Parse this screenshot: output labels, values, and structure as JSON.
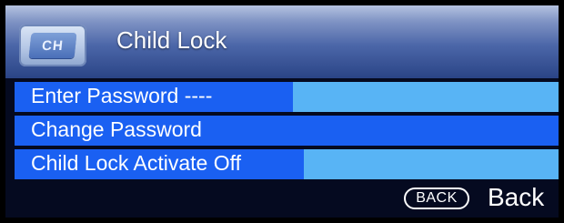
{
  "menu": {
    "logo_text": "CH",
    "title": "Child Lock",
    "items": [
      {
        "label": "Enter Password ----"
      },
      {
        "label": "Change Password"
      },
      {
        "label": "Child Lock Activate Off"
      }
    ]
  },
  "footer": {
    "back_key": "BACK",
    "back_label": "Back"
  },
  "colors": {
    "row_blue": "#1a60f2",
    "field_light_blue": "#58b4f5",
    "header_gradient_top": "#b4c2e0",
    "header_gradient_bottom": "#2a4486",
    "panel_background": "#050a20"
  }
}
